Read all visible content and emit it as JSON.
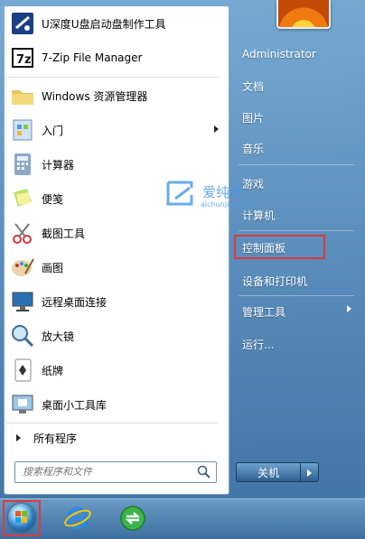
{
  "left_programs": [
    {
      "label": "U深度U盘启动盘制作工具",
      "icon": "udeep-usb-tool-icon"
    },
    {
      "label": "7-Zip File Manager",
      "icon": "7zip-icon"
    },
    {
      "label": "Windows 资源管理器",
      "icon": "explorer-folder-icon"
    },
    {
      "label": "入门",
      "icon": "getting-started-icon",
      "has_submenu": true
    },
    {
      "label": "计算器",
      "icon": "calculator-icon"
    },
    {
      "label": "便笺",
      "icon": "sticky-notes-icon"
    },
    {
      "label": "截图工具",
      "icon": "snipping-tool-icon"
    },
    {
      "label": "画图",
      "icon": "paint-icon"
    },
    {
      "label": "远程桌面连接",
      "icon": "remote-desktop-icon"
    },
    {
      "label": "放大镜",
      "icon": "magnifier-icon"
    },
    {
      "label": "纸牌",
      "icon": "solitaire-icon"
    },
    {
      "label": "桌面小工具库",
      "icon": "gadgets-icon"
    }
  ],
  "all_programs": "所有程序",
  "search": {
    "placeholder": "搜索程序和文件"
  },
  "right_items": [
    {
      "label": "Administrator"
    },
    {
      "label": "文档"
    },
    {
      "label": "图片"
    },
    {
      "label": "音乐"
    },
    {
      "label": "游戏"
    },
    {
      "label": "计算机"
    },
    {
      "label": "控制面板",
      "highlighted": true
    },
    {
      "label": "设备和打印机"
    },
    {
      "label": "管理工具",
      "has_submenu": true
    },
    {
      "label": "运行..."
    }
  ],
  "shutdown": {
    "label": "关机"
  },
  "watermark": {
    "text": "爱纯净",
    "sub": "aichunjing.com"
  },
  "taskbar": {
    "items": [
      "start-orb-icon",
      "internet-explorer-icon",
      "media-update-icon"
    ]
  },
  "colors": {
    "highlight": "#e0393e",
    "menu_bg": "#5c8fbf"
  }
}
